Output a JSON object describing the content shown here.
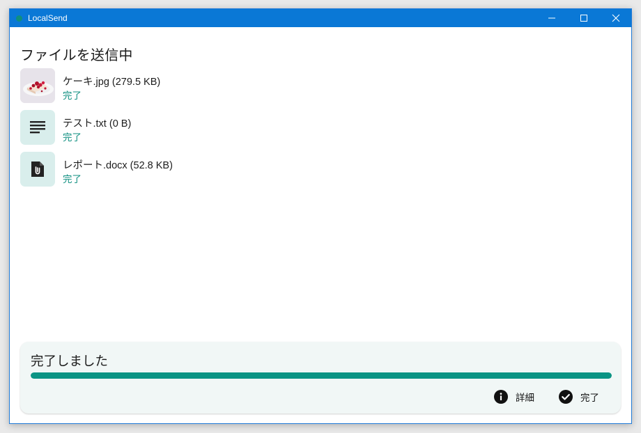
{
  "window": {
    "title": "LocalSend"
  },
  "page": {
    "title": "ファイルを送信中"
  },
  "files": [
    {
      "name": "ケーキ.jpg (279.5 KB)",
      "status": "完了",
      "icon": "image-thumbnail"
    },
    {
      "name": "テスト.txt (0 B)",
      "status": "完了",
      "icon": "text-lines-icon"
    },
    {
      "name": "レポート.docx (52.8 KB)",
      "status": "完了",
      "icon": "attachment-file-icon"
    }
  ],
  "summary": {
    "title": "完了しました",
    "progress": 1.0,
    "details_label": "詳細",
    "done_label": "完了"
  },
  "colors": {
    "titlebar": "#0a78d6",
    "accent": "#0b9484",
    "status_text": "#0f8f80",
    "panel_bg": "#f1f7f6"
  }
}
